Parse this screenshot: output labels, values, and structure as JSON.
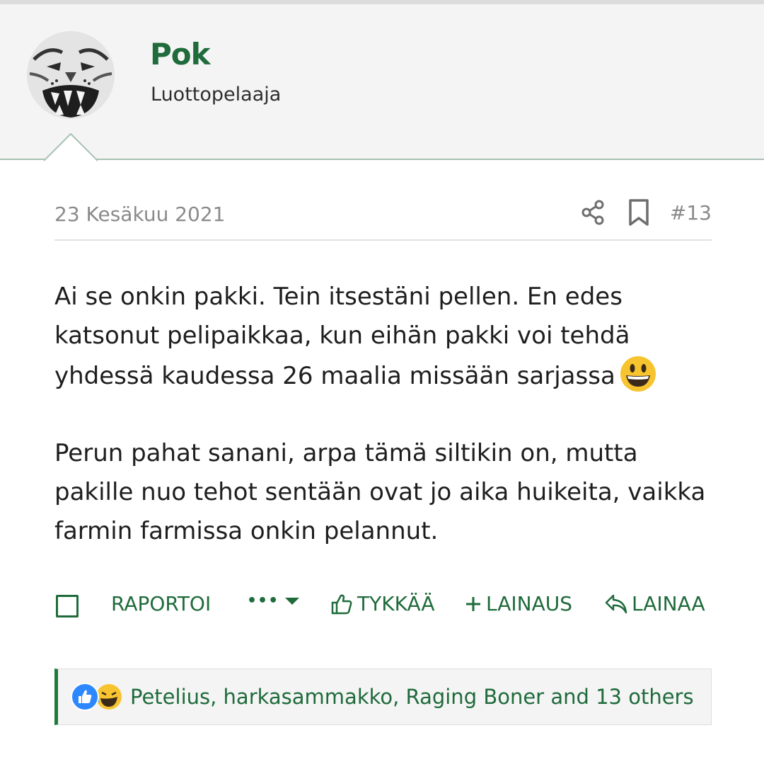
{
  "user": {
    "name": "Pok",
    "title": "Luottopelaaja"
  },
  "post": {
    "date": "23 Kesäkuu 2021",
    "number": "#13",
    "paragraph1": "Ai se onkin pakki. Tein itsestäni pellen. En edes katsonut pelipaikkaa, kun eihän pakki voi tehdä yhdessä kaudessa 26 maalia missään sarjassa",
    "paragraph2": "Perun pahat sanani, arpa tämä siltikin on, mutta pakille nuo tehot sentään ovat jo aika huikeita, vaikka farmin farmissa onkin pelannut."
  },
  "actions": {
    "report": "RAPORTOI",
    "more": "•••",
    "like": "TYKKÄÄ",
    "multiquote": "LAINAUS",
    "reply": "LAINAA"
  },
  "reactions": {
    "text": "Petelius, harkasammakko, Raging Boner and 13 others"
  },
  "icons": [
    "share-icon",
    "bookmark-icon",
    "thumbs-up-icon",
    "plus-icon",
    "reply-arrow-icon",
    "grinning-emoji",
    "laugh-emoji",
    "like-reaction-icon",
    "chevron-down-icon"
  ],
  "colors": {
    "accent": "#1f6b3b",
    "header_bg": "#f4f4f4",
    "meta_text": "#8a8a8a"
  }
}
